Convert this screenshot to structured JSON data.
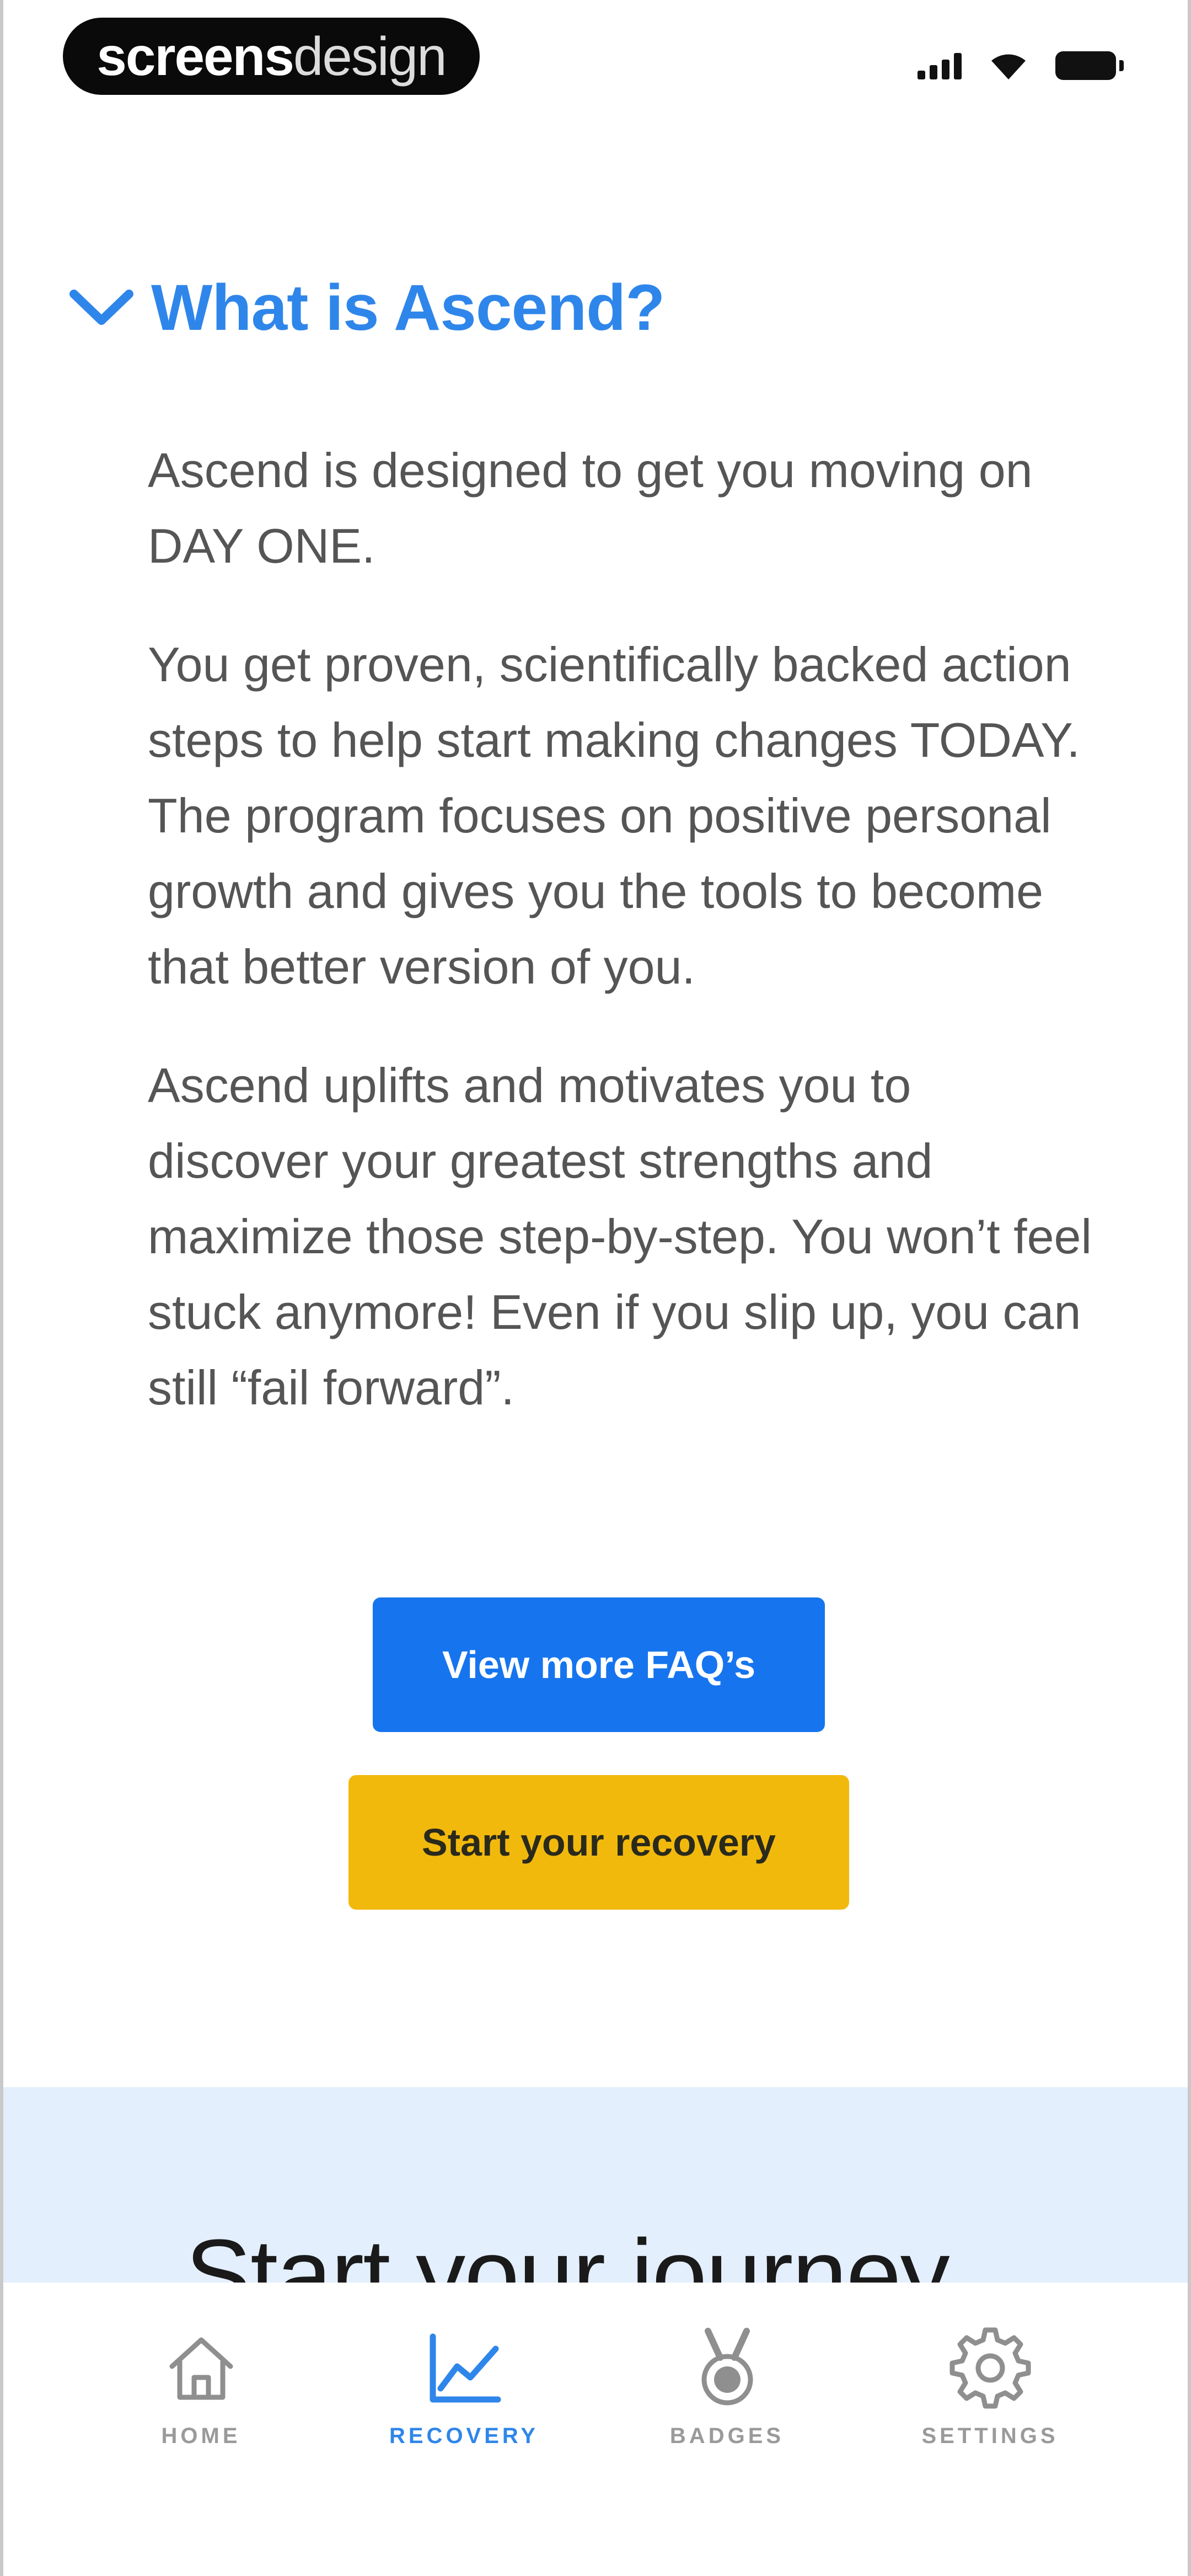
{
  "status_bar": {
    "watermark_bold": "screens",
    "watermark_light": "design",
    "icons": [
      "signal-icon",
      "wifi-icon",
      "battery-icon"
    ]
  },
  "faq": {
    "title": "What is Ascend?",
    "expanded": true,
    "paragraphs": [
      "Ascend is designed to get you moving on DAY ONE.",
      "You get proven, scientifically backed action steps to help start making changes TODAY. The program focuses on positive personal growth and gives you the tools to become that better version of you.",
      "Ascend uplifts and motivates you to discover your greatest strengths and maximize those step-by-step. You won’t feel stuck anymore! Even if you slip up, you can still “fail forward”."
    ]
  },
  "buttons": {
    "view_faqs": "View more FAQ’s",
    "start_recovery": "Start your recovery"
  },
  "journey": {
    "title": "Start your journey"
  },
  "tabbar": {
    "active": "recovery",
    "tabs": [
      {
        "id": "home",
        "label": "HOME",
        "icon": "home-icon"
      },
      {
        "id": "recovery",
        "label": "RECOVERY",
        "icon": "chart-icon"
      },
      {
        "id": "badges",
        "label": "BADGES",
        "icon": "medal-icon"
      },
      {
        "id": "settings",
        "label": "SETTINGS",
        "icon": "gear-icon"
      }
    ]
  },
  "colors": {
    "accent_blue": "#2f86ea",
    "button_blue": "#1675ee",
    "button_yellow": "#f2b90d",
    "journey_bg": "#e3effc"
  }
}
